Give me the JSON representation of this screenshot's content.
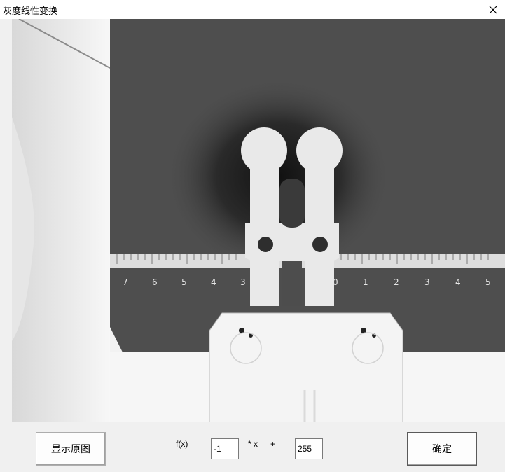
{
  "window": {
    "title": "灰度线性变换",
    "close_icon": "close-icon"
  },
  "toolbar": {
    "show_original_label": "显示原图",
    "fx_label": "f(x) =",
    "multiply_label": "* x",
    "plus_label": "+",
    "slope_value": "-1",
    "intercept_value": "255",
    "confirm_label": "确定"
  },
  "ruler": {
    "ticks_left": [
      "7",
      "6",
      "5",
      "4",
      "3"
    ],
    "ticks_right": [
      "0",
      "1",
      "2",
      "3",
      "4",
      "5"
    ]
  },
  "colors": {
    "background": "#f0f0f0",
    "plate_dark": "#4a4a4a",
    "bright": "#f2f2f2"
  }
}
